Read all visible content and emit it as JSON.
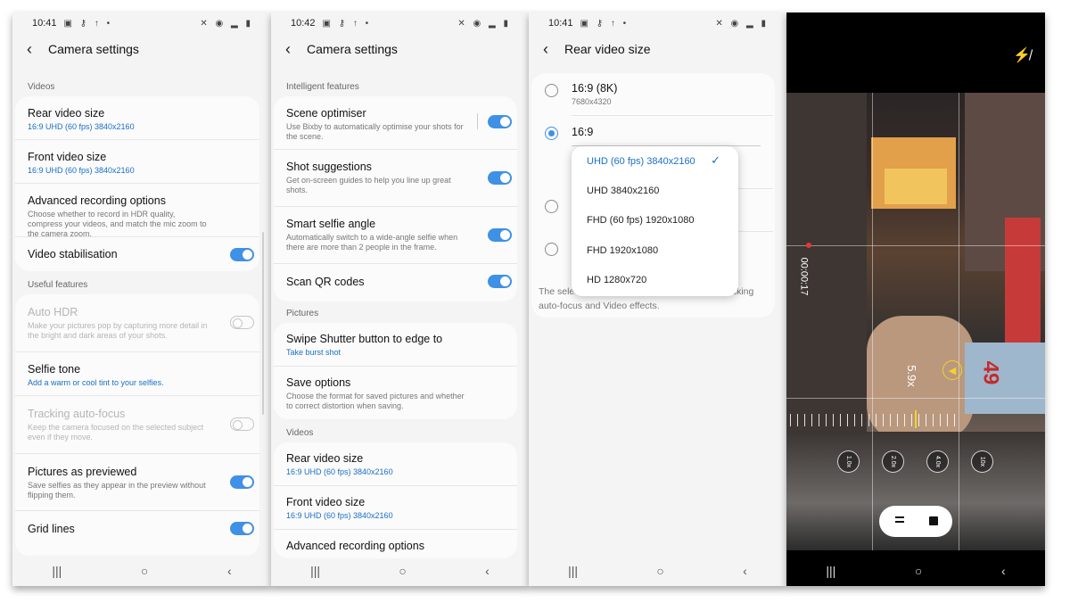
{
  "panel1": {
    "status_time": "10:41",
    "status_left": "▣ ⚷ ↑ •",
    "status_right": "✕ ◉ ▂ ▮",
    "title": "Camera settings",
    "section_videos": "Videos",
    "rows_videos": [
      {
        "title": "Rear video size",
        "value": "16:9 UHD (60 fps) 3840x2160"
      },
      {
        "title": "Front video size",
        "value": "16:9 UHD (60 fps) 3840x2160"
      },
      {
        "title": "Advanced recording options",
        "desc": "Choose whether to record in HDR quality, compress your videos, and match the mic zoom to the camera zoom."
      },
      {
        "title": "Video stabilisation",
        "toggle": true
      }
    ],
    "section_useful": "Useful features",
    "rows_useful": [
      {
        "title": "Auto HDR",
        "desc": "Make your pictures pop by capturing more detail in the bright and dark areas of your shots.",
        "toggle": false,
        "disabled": true
      },
      {
        "title": "Selfie tone",
        "value": "Add a warm or cool tint to your selfies."
      },
      {
        "title": "Tracking auto-focus",
        "desc": "Keep the camera focused on the selected subject even if they move.",
        "toggle": false,
        "disabled": true
      },
      {
        "title": "Pictures as previewed",
        "desc": "Save selfies as they appear in the preview without flipping them.",
        "toggle": true
      },
      {
        "title": "Grid lines",
        "toggle": true
      }
    ]
  },
  "panel2": {
    "status_time": "10:42",
    "status_left": "▣ ⚷ ↑ •",
    "status_right": "✕ ◉ ▂ ▮",
    "title": "Camera settings",
    "section_intelligent": "Intelligent features",
    "rows_intelligent": [
      {
        "title": "Scene optimiser",
        "desc": "Use Bixby to automatically optimise your shots for the scene.",
        "toggle": true
      },
      {
        "title": "Shot suggestions",
        "desc": "Get on-screen guides to help you line up great shots.",
        "toggle": true
      },
      {
        "title": "Smart selfie angle",
        "desc": "Automatically switch to a wide-angle selfie when there are more than 2 people in the frame.",
        "toggle": true
      },
      {
        "title": "Scan QR codes",
        "toggle": true
      }
    ],
    "section_pictures": "Pictures",
    "rows_pictures": [
      {
        "title": "Swipe Shutter button to edge to",
        "value": "Take burst shot"
      },
      {
        "title": "Save options",
        "desc": "Choose the format for saved pictures and whether to correct distortion when saving."
      }
    ],
    "section_videos": "Videos",
    "rows_videos": [
      {
        "title": "Rear video size",
        "value": "16:9 UHD (60 fps) 3840x2160"
      },
      {
        "title": "Front video size",
        "value": "16:9 UHD (60 fps) 3840x2160"
      },
      {
        "title": "Advanced recording options"
      }
    ]
  },
  "panel3": {
    "status_time": "10:41",
    "status_left": "▣ ⚷ ↑ •",
    "status_right": "✕ ◉ ▂ ▮",
    "title": "Rear video size",
    "option1_title": "16:9 (8K)",
    "option1_sub": "7680x4320",
    "option2_title": "16:9",
    "footer_left": "The selec",
    "footer_right": "pp tracking",
    "footer_line2": "auto-focus and Video effects.",
    "dropdown": [
      {
        "label": "UHD (60 fps) 3840x2160",
        "selected": true
      },
      {
        "label": "UHD 3840x2160"
      },
      {
        "label": "FHD (60 fps) 1920x1080"
      },
      {
        "label": "FHD 1920x1080"
      },
      {
        "label": "HD 1280x720"
      }
    ]
  },
  "panel4": {
    "timer": "00:00:17",
    "zoom_level": "5.9x",
    "zoom_buttons": [
      "1.0x",
      "2.0x",
      "4.0x",
      "10x"
    ],
    "sign_text": "49"
  },
  "nav": {
    "recent": "|||",
    "home": "○",
    "back": "‹"
  },
  "colors": {
    "accent": "#3e91e5",
    "link": "#1a6fc4",
    "record": "#e53935"
  }
}
